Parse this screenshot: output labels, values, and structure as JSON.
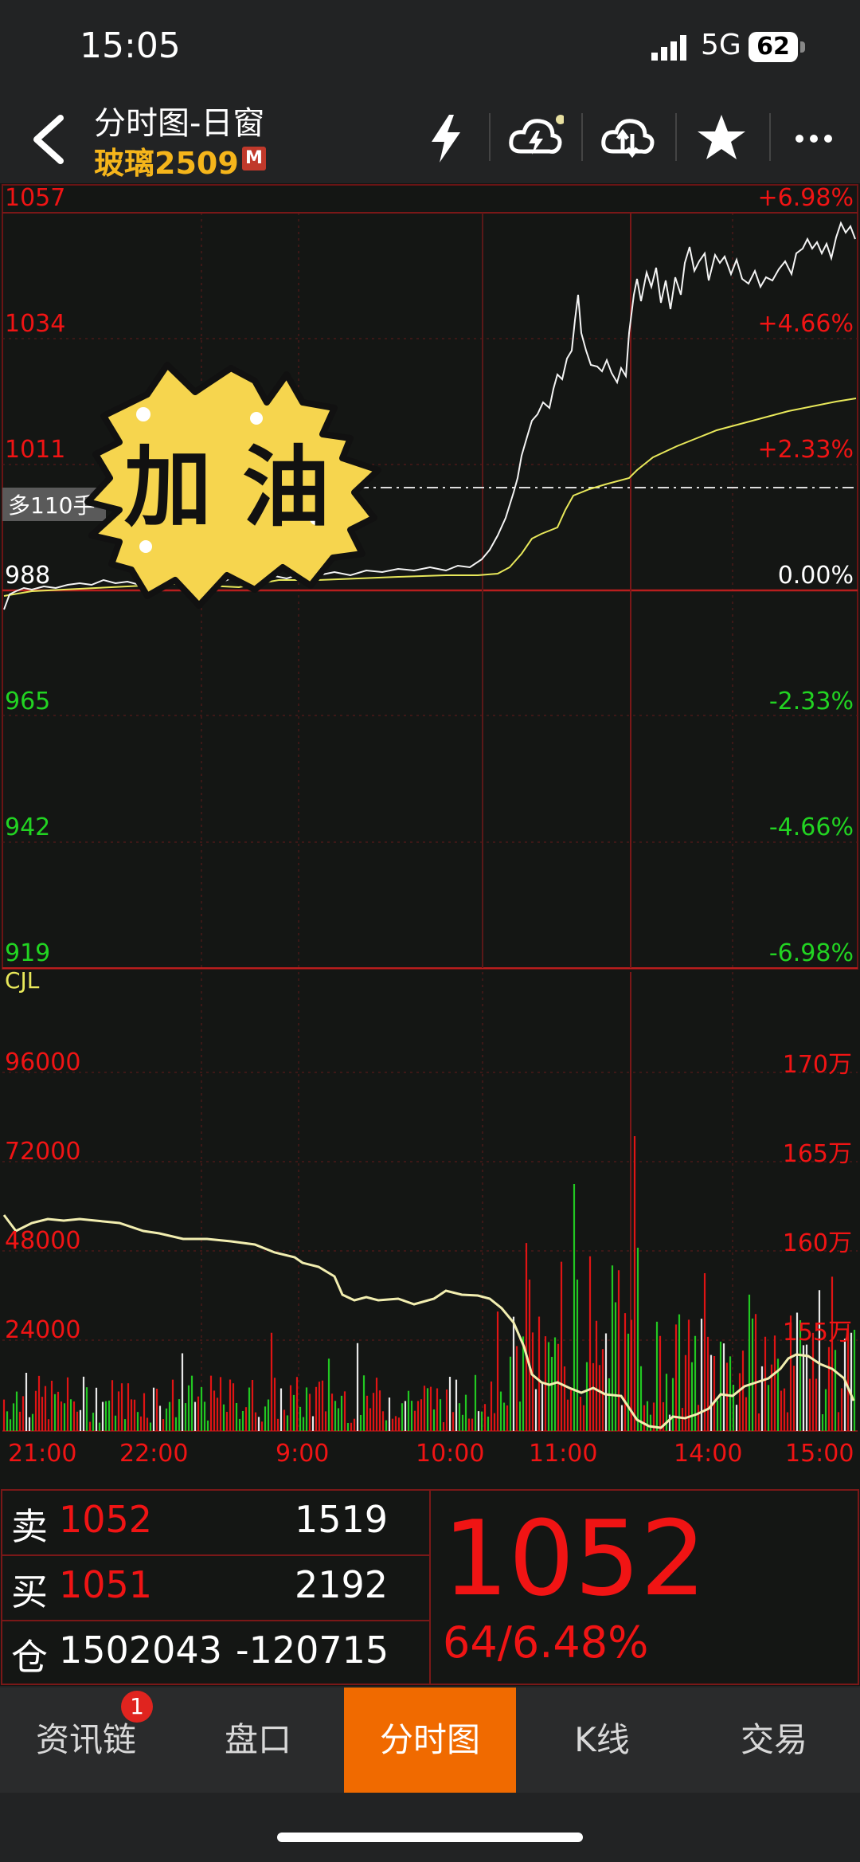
{
  "status_bar": {
    "time": "15:05",
    "network": "5G",
    "battery": "62"
  },
  "header": {
    "title": "分时图-日窗",
    "symbol": "玻璃2509",
    "badge": "M",
    "icons": [
      "lightning-icon",
      "cloud-lightning-icon",
      "cloud-sync-icon",
      "star-icon",
      "more-icon"
    ]
  },
  "price_axis": {
    "left_labels": [
      "1057",
      "1034",
      "1011",
      "988",
      "965",
      "942",
      "919"
    ],
    "right_labels": [
      "+6.98%",
      "+4.66%",
      "+2.33%",
      "0.00%",
      "-2.33%",
      "-4.66%",
      "-6.98%"
    ],
    "position_tag": "多110手"
  },
  "sticker": {
    "text": "加 油"
  },
  "volume_axis": {
    "indicator": "CJL",
    "left_labels": [
      "96000",
      "72000",
      "48000",
      "24000"
    ],
    "right_labels": [
      "170万",
      "165万",
      "160万",
      "155万"
    ]
  },
  "time_labels": [
    "21:00",
    "22:00",
    "9:00",
    "10:00",
    "11:00",
    "14:00",
    "15:00"
  ],
  "quote": {
    "sell_label": "卖",
    "sell_price": "1052",
    "sell_qty": "1519",
    "buy_label": "买",
    "buy_price": "1051",
    "buy_qty": "2192",
    "oi_label": "仓",
    "open_interest": "1502043",
    "oi_change": "-120715",
    "last_price": "1052",
    "change": "64/6.48%"
  },
  "tabs": [
    {
      "label": "资讯链",
      "badge": "1"
    },
    {
      "label": "盘口"
    },
    {
      "label": "分时图",
      "active": true
    },
    {
      "label": "K线"
    },
    {
      "label": "交易"
    }
  ],
  "colors": {
    "up": "#f01414",
    "down": "#22d422",
    "accent": "#f06a00",
    "avg_line": "#e8e85a",
    "symbol": "#f5b51b"
  }
}
